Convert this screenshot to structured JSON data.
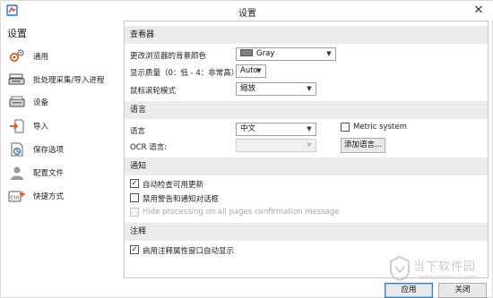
{
  "window": {
    "title": "设置",
    "close_glyph": "✕"
  },
  "sidebar": {
    "title": "设置",
    "items": [
      {
        "label": "通用",
        "icon": "gear-icon"
      },
      {
        "label": "批处理采集/导入进程",
        "icon": "scanner-icon"
      },
      {
        "label": "设备",
        "icon": "device-icon"
      },
      {
        "label": "导入",
        "icon": "import-icon"
      },
      {
        "label": "保存选项",
        "icon": "save-options-icon"
      },
      {
        "label": "配置文件",
        "icon": "profile-icon"
      },
      {
        "label": "快捷方式",
        "icon": "shortcut-icon"
      }
    ]
  },
  "sections": {
    "viewer": {
      "title": "查看器",
      "bg_color_label": "更改浏览器的背景颜色",
      "bg_color_value": "Gray",
      "quality_label": "显示质量（0：低 - 4：非常高）",
      "quality_value": "Auto",
      "scroll_label": "鼠标滚轮模式",
      "scroll_value": "缩放"
    },
    "language": {
      "title": "语言",
      "language_label": "语言",
      "language_value": "中文",
      "metric_label": "Metric system",
      "metric_checked": false,
      "ocr_label": "OCR 语言:",
      "ocr_value": "",
      "add_language_button": "添加语言..."
    },
    "notifications": {
      "title": "通知",
      "auto_update_label": "自动检查可用更新",
      "auto_update_checked": true,
      "disable_warnings_label": "禁用警告和通知对话框",
      "disable_warnings_checked": false,
      "hide_processing_label": "Hide processing on all pages confirmation message",
      "hide_processing_checked": false
    },
    "annotations": {
      "title": "注释",
      "auto_show_label": "启用注释属性窗口自动显示",
      "auto_show_checked": true
    }
  },
  "footer": {
    "apply_button": "应用",
    "close_button": "关闭"
  },
  "watermark": {
    "text": "当下软件园",
    "url": "www.downxia.com"
  },
  "colors": {
    "section_bg": "#ececec",
    "border": "#c8c8c8",
    "primary_focus": "#3b7bd4",
    "swatch_gray": "#808080"
  }
}
